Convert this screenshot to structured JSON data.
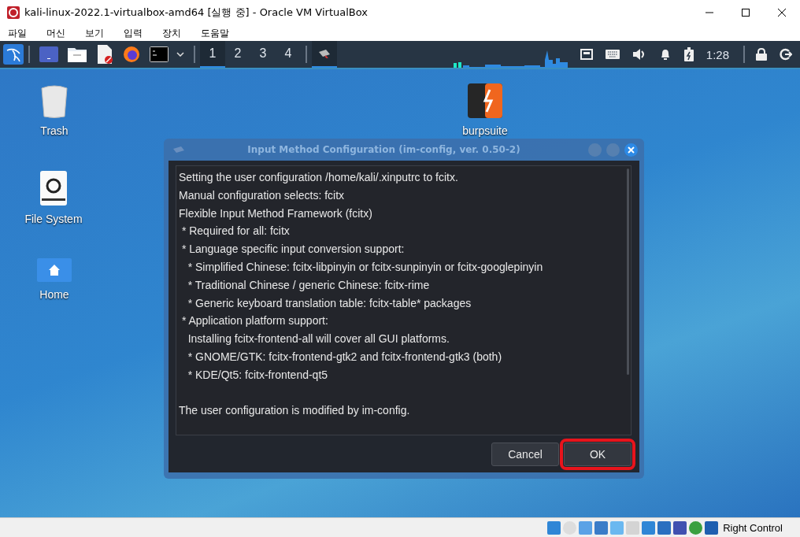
{
  "window": {
    "title": "kali-linux-2022.1-virtualbox-amd64 [실행 중] - Oracle VM VirtualBox"
  },
  "menu": [
    "파일",
    "머신",
    "보기",
    "입력",
    "장치",
    "도움말"
  ],
  "panel": {
    "workspaces": [
      {
        "label": "1",
        "selected": true
      },
      {
        "label": "2",
        "selected": false
      },
      {
        "label": "3",
        "selected": false
      },
      {
        "label": "4",
        "selected": false
      }
    ],
    "clock": "1:28"
  },
  "desktop_icons": [
    {
      "label": "Trash",
      "kind": "trash"
    },
    {
      "label": "File System",
      "kind": "drive"
    },
    {
      "label": "Home",
      "kind": "home"
    },
    {
      "label": "burpsuite",
      "kind": "burp"
    }
  ],
  "dialog": {
    "title": "Input Method Configuration (im-config, ver. 0.50-2)",
    "lines": [
      "Setting the user configuration /home/kali/.xinputrc to fcitx.",
      "Manual configuration selects: fcitx",
      "Flexible Input Method Framework (fcitx)",
      " * Required for all: fcitx",
      " * Language specific input conversion support:",
      "   * Simplified Chinese: fcitx-libpinyin or fcitx-sunpinyin or fcitx-googlepinyin",
      "   * Traditional Chinese / generic Chinese: fcitx-rime",
      "   * Generic keyboard translation table: fcitx-table* packages",
      " * Application platform support:",
      "   Installing fcitx-frontend-all will cover all GUI platforms.",
      "   * GNOME/GTK: fcitx-frontend-gtk2 and fcitx-frontend-gtk3 (both)",
      "   * KDE/Qt5: fcitx-frontend-qt5"
    ],
    "footer": "The user configuration is modified by im-config.",
    "buttons": [
      {
        "label": "Cancel",
        "highlighted": false
      },
      {
        "label": "OK",
        "highlighted": true
      }
    ]
  },
  "status_bar": {
    "host_key": "Right Control"
  }
}
